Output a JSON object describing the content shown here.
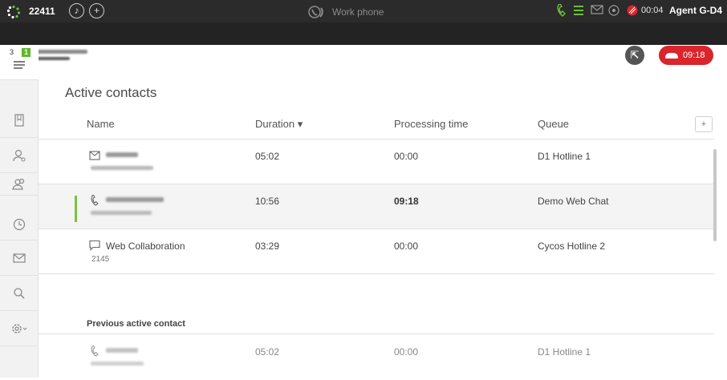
{
  "topbar": {
    "extension": "22411",
    "phone_mode": "Work phone",
    "small_timer": "00:04",
    "agent": "Agent G-D4 ⌄",
    "hangup_time": "09:18",
    "pause_icon": "pause-icon",
    "transfer_icon": "transfer-icon",
    "accent_green": "#6bbf3a",
    "hangup_red": "#d9252b"
  },
  "sidebar": {
    "queue_count": "3",
    "new_badge": "1",
    "items": [
      "list-icon",
      "book-icon",
      "user-add-icon",
      "users-icon",
      "clock-icon",
      "mail-icon",
      "search-icon",
      "settings-icon"
    ]
  },
  "main": {
    "title": "Active contacts",
    "columns": {
      "name": "Name",
      "duration": "Duration ▾",
      "processing": "Processing time",
      "queue": "Queue",
      "add": "+"
    },
    "rows": [
      {
        "channel": "mail-icon",
        "duration": "05:02",
        "processing": "00:00",
        "queue": "D1 Hotline 1"
      },
      {
        "channel": "phone-icon",
        "duration": "10:56",
        "processing": "09:18",
        "queue": "Demo Web Chat"
      },
      {
        "channel": "chat-icon",
        "name": "Web Collaboration",
        "sub": "2145",
        "duration": "03:29",
        "processing": "00:00",
        "queue": "Cycos Hotline 2"
      }
    ],
    "previous_title": "Previous active contact",
    "previous_row": {
      "channel": "phone-icon",
      "duration": "05:02",
      "processing": "00:00",
      "queue": "D1 Hotline 1"
    }
  }
}
